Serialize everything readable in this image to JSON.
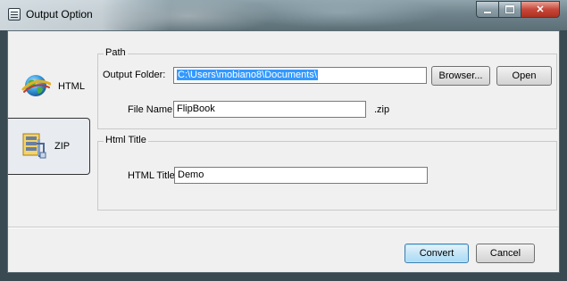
{
  "window": {
    "title": "Output Option"
  },
  "tabs": [
    {
      "label": "HTML",
      "icon": "globe-icon"
    },
    {
      "label": "ZIP",
      "icon": "zip-archive-icon"
    }
  ],
  "path_group": {
    "legend": "Path",
    "output_folder_label": "Output Folder:",
    "output_folder_value": "C:\\Users\\mobiano8\\Documents\\",
    "browse_label": "Browser...",
    "open_label": "Open",
    "file_name_label": "File Name:",
    "file_name_value": "FlipBook",
    "extension": ".zip"
  },
  "html_title_group": {
    "legend": "Html Title",
    "html_title_label": "HTML Title",
    "html_title_value": "Demo"
  },
  "footer": {
    "convert_label": "Convert",
    "cancel_label": "Cancel"
  },
  "colors": {
    "selection": "#3399ff",
    "close_button": "#c6483a"
  }
}
